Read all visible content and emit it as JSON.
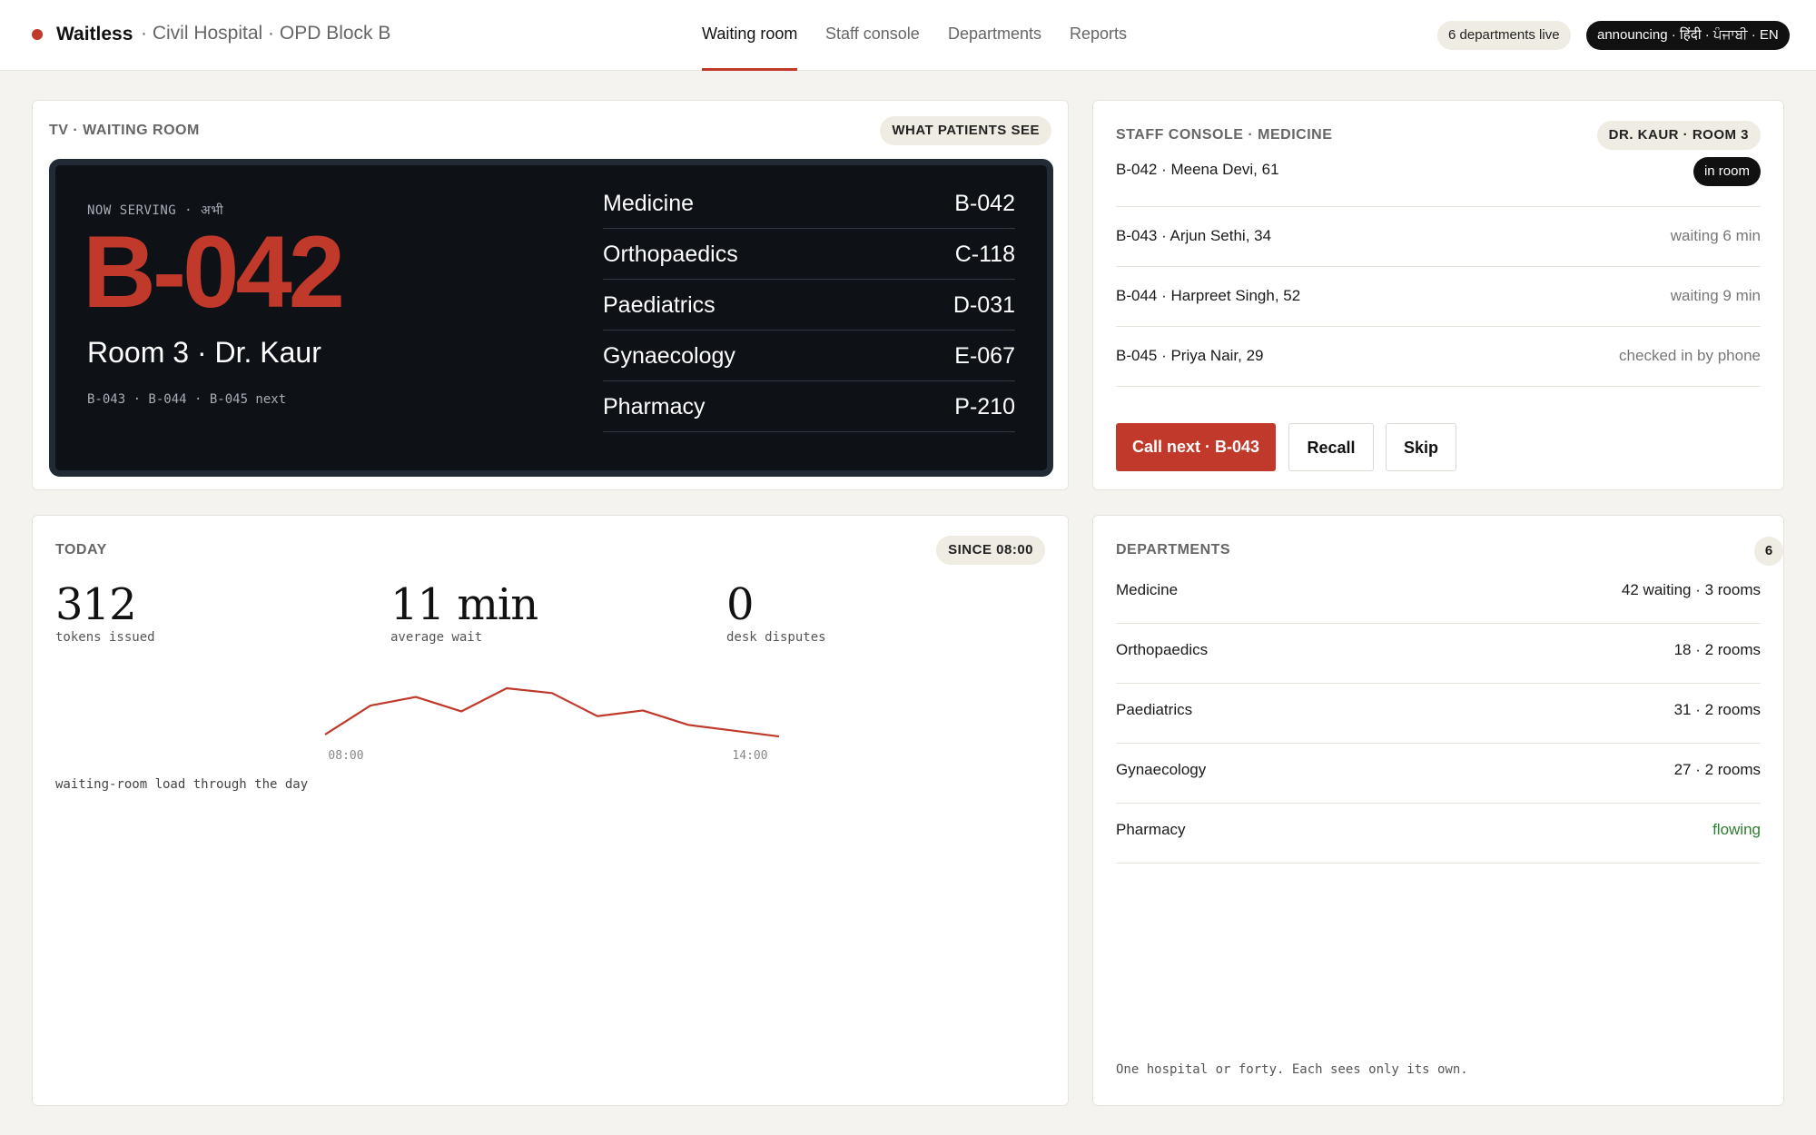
{
  "header": {
    "brand": "Waitless",
    "location": "· Civil Hospital · OPD Block B",
    "nav": [
      "Waiting room",
      "Staff console",
      "Departments",
      "Reports"
    ],
    "active_nav": "Waiting room",
    "live_pill": "6 departments live",
    "lang_pill": "announcing · हिंदी · ਪੰਜਾਬੀ · EN"
  },
  "tv": {
    "label": "TV · WAITING ROOM",
    "chip": "WHAT PATIENTS SEE",
    "now_serving": "NOW SERVING · अभी",
    "token": "B-042",
    "room": "Room 3 · Dr. Kaur",
    "next": "B-043 · B-044 · B-045 next",
    "departments": [
      {
        "name": "Medicine",
        "token": "B-042"
      },
      {
        "name": "Orthopaedics",
        "token": "C-118"
      },
      {
        "name": "Paediatrics",
        "token": "D-031"
      },
      {
        "name": "Gynaecology",
        "token": "E-067"
      },
      {
        "name": "Pharmacy",
        "token": "P-210"
      }
    ]
  },
  "console": {
    "label": "STAFF CONSOLE · MEDICINE",
    "chip": "DR. KAUR · ROOM 3",
    "queue": [
      {
        "name": "B-042 · Meena Devi, 61",
        "status": "in room"
      },
      {
        "name": "B-043 · Arjun Sethi, 34",
        "status": "waiting 6 min"
      },
      {
        "name": "B-044 · Harpreet Singh, 52",
        "status": "waiting 9 min"
      },
      {
        "name": "B-045 · Priya Nair, 29",
        "status": "checked in by phone"
      }
    ],
    "call_next": "Call next · B-043",
    "recall": "Recall",
    "skip": "Skip"
  },
  "today": {
    "label": "TODAY",
    "chip": "SINCE 08:00",
    "stats": [
      {
        "value": "312",
        "label": "tokens issued"
      },
      {
        "value": "11 min",
        "label": "average wait"
      },
      {
        "value": "0",
        "label": "desk disputes"
      }
    ],
    "chart_caption": "waiting-room load through the day"
  },
  "chart_data": {
    "type": "line",
    "x_labels": [
      "08:00",
      "14:00"
    ],
    "series": [
      {
        "values": [
          1,
          31,
          40,
          25,
          49,
          44,
          20,
          26,
          11,
          5,
          -1
        ]
      }
    ],
    "color": "#c0392b"
  },
  "departments": {
    "label": "DEPARTMENTS",
    "count": "6",
    "rows": [
      {
        "name": "Medicine",
        "value": "42 waiting · 3 rooms"
      },
      {
        "name": "Orthopaedics",
        "value": "18 · 2 rooms"
      },
      {
        "name": "Paediatrics",
        "value": "31 · 2 rooms"
      },
      {
        "name": "Gynaecology",
        "value": "27 · 2 rooms"
      },
      {
        "name": "Pharmacy",
        "value": "flowing"
      }
    ],
    "footer": "One hospital or forty. Each sees only its own."
  },
  "colors": {
    "accent": "#c0392b",
    "flowing": "#2e7d32"
  }
}
